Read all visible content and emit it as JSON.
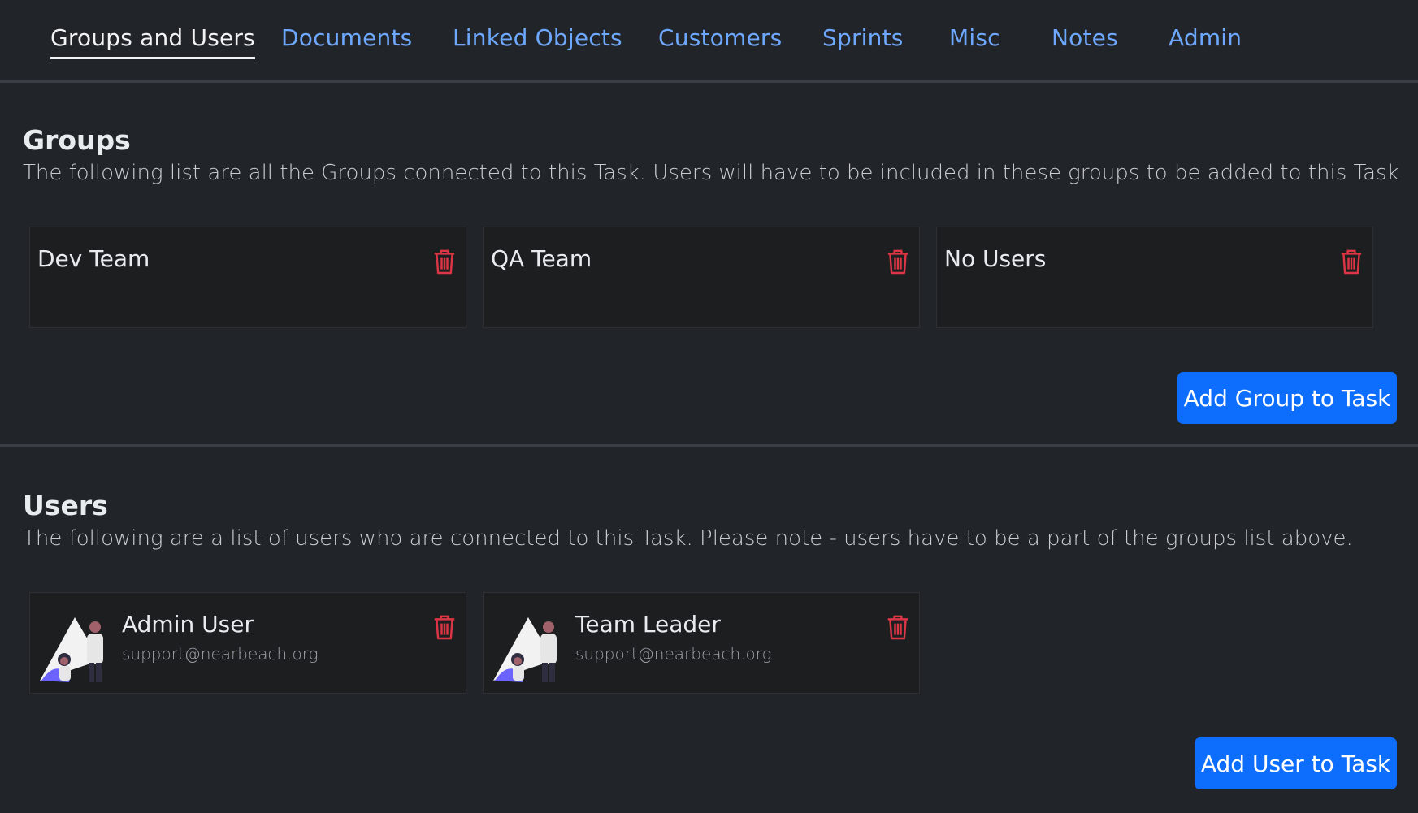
{
  "tabs": [
    {
      "label": "Groups and Users",
      "active": true
    },
    {
      "label": "Documents"
    },
    {
      "label": "Linked Objects"
    },
    {
      "label": "Customers"
    },
    {
      "label": "Sprints"
    },
    {
      "label": "Misc"
    },
    {
      "label": "Notes"
    },
    {
      "label": "Admin"
    }
  ],
  "groups": {
    "title": "Groups",
    "description": "The following list are all the Groups connected to this Task. Users will have to be included in these groups to be added to this Task",
    "items": [
      {
        "name": "Dev Team"
      },
      {
        "name": "QA Team"
      },
      {
        "name": "No Users"
      }
    ],
    "add_button": "Add Group to Task"
  },
  "users": {
    "title": "Users",
    "description": "The following are a list of users who are connected to this Task. Please note - users have to be a part of the groups list above.",
    "items": [
      {
        "name": "Admin User",
        "email": "support@nearbeach.org"
      },
      {
        "name": "Team Leader",
        "email": "support@nearbeach.org"
      }
    ],
    "add_button": "Add User to Task"
  },
  "colors": {
    "background": "#212429",
    "link": "#6ea8fe",
    "primary": "#0d6efd",
    "danger": "#dc3545"
  },
  "icons": {
    "delete": "trash-icon",
    "avatar": "user-avatar-illustration"
  }
}
